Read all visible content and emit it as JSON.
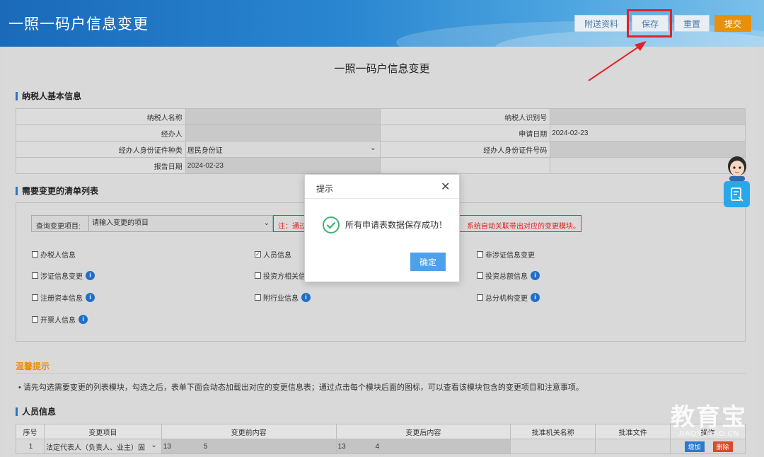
{
  "header": {
    "title": "一照一码户信息变更",
    "buttons": {
      "attach": "附送资料",
      "save": "保存",
      "reset": "重置",
      "submit": "提交"
    }
  },
  "form": {
    "title": "一照一码户信息变更"
  },
  "taxpayer": {
    "section_title": "纳税人基本信息",
    "rows": [
      {
        "l1": "纳税人名称",
        "v1": "",
        "l2": "纳税人识别号",
        "v2": ""
      },
      {
        "l1": "经办人",
        "v1": "",
        "l2": "申请日期",
        "v2": "2024-02-23"
      },
      {
        "l1": "经办人身份证件种类",
        "v1": "居民身份证",
        "l2": "经办人身份证件号码",
        "v2": ""
      },
      {
        "l1": "报告日期",
        "v1": "2024-02-23",
        "l2": "",
        "v2": ""
      }
    ]
  },
  "change_list": {
    "section_title": "需要变更的清单列表",
    "query_label": "查询变更项目:",
    "query_placeholder": "请输入变更的项目",
    "note_part1": "注：通过变更",
    "note_part2": "系统自动关联带出对应的变更模块。",
    "items": [
      {
        "label": "办税人信息",
        "checked": false,
        "info": false
      },
      {
        "label": "人员信息",
        "checked": true,
        "info": false
      },
      {
        "label": "非涉证信息变更",
        "checked": false,
        "info": false
      },
      {
        "label": "涉证信息变更",
        "checked": false,
        "info": true
      },
      {
        "label": "投资方相关信",
        "checked": false,
        "info": false
      },
      {
        "label": "投资总额信息",
        "checked": false,
        "info": true
      },
      {
        "label": "注册资本信息",
        "checked": false,
        "info": true
      },
      {
        "label": "附行业信息",
        "checked": false,
        "info": true
      },
      {
        "label": "总分机构变更",
        "checked": false,
        "info": true
      },
      {
        "label": "开票人信息",
        "checked": false,
        "info": true
      }
    ]
  },
  "tips": {
    "title": "温馨提示",
    "text": "• 请先勾选需要变更的列表模块，勾选之后，表单下面会动态加载出对应的变更信息表；通过点击每个模块后面的图标，可以查看该模块包含的变更项目和注意事项。"
  },
  "person": {
    "section_title": "人员信息",
    "columns": [
      "序号",
      "变更项目",
      "变更前内容",
      "变更后内容",
      "批准机关名称",
      "批准文件",
      "操作"
    ],
    "rows": [
      {
        "no": "1",
        "item": "法定代表人（负责人、业主）固",
        "before_a": "13",
        "before_b": "5",
        "after_a": "13",
        "after_b": "4",
        "add": "增加",
        "del": "删除"
      }
    ]
  },
  "modal": {
    "title": "提示",
    "close": "✕",
    "message": "所有申请表数据保存成功！",
    "ok": "确定"
  },
  "watermark": {
    "big": "教育宝",
    "small": "JIAOYUBAO.CN"
  },
  "colors": {
    "accent": "#2b74c4",
    "submit": "#e8900e",
    "highlight": "#e3212a",
    "success": "#3cb371"
  }
}
